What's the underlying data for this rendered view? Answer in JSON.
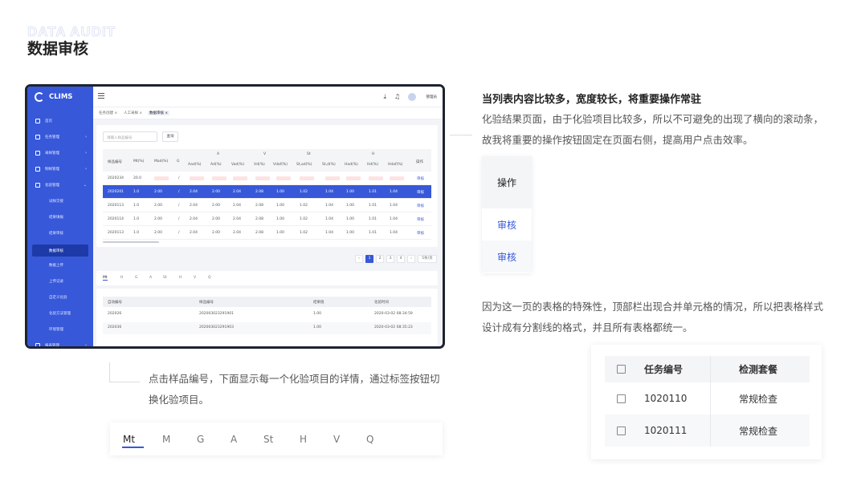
{
  "page": {
    "eyebrow": "DATA AUDIT",
    "title": "数据审核"
  },
  "app": {
    "logo": "CLIMS",
    "user": "管理员",
    "sidebar": {
      "items": [
        {
          "label": "首页"
        },
        {
          "label": "任务管理"
        },
        {
          "label": "采样管理"
        },
        {
          "label": "制样管理"
        },
        {
          "label": "化验管理"
        }
      ],
      "sub_items": [
        {
          "label": "试样交接"
        },
        {
          "label": "结果填报"
        },
        {
          "label": "结果审核"
        }
      ],
      "active": "数据审核",
      "sub_items_after": [
        {
          "label": "数据上传"
        },
        {
          "label": "上传记录"
        },
        {
          "label": "自定义化验"
        },
        {
          "label": "化验方法管理"
        },
        {
          "label": "环境管理"
        }
      ],
      "bottom": "报表管理"
    },
    "breadcrumbs": [
      "任务创建 ×",
      "人工采样 ×",
      "数据审核 ×"
    ],
    "search_placeholder": "请输入样品编号",
    "search_button": "查询",
    "table": {
      "group_headers": [
        "A",
        "V",
        "St",
        "H"
      ],
      "columns": [
        "样品编号",
        "Mt(%)",
        "Mad(%)",
        "G",
        "Aad(%)",
        "Ad(%)",
        "Vad(%)",
        "Vd(%)",
        "Vdaf(%)",
        "St,ad(%)",
        "St,d(%)",
        "Had(%)",
        "Hd(%)",
        "Hdaf(%)",
        "操作"
      ],
      "rows": [
        {
          "id": "2020234",
          "mt": "20.0",
          "mad": "",
          "g": "/",
          "aad": "",
          "ad": "",
          "vad": "",
          "vd": "",
          "vdaf": "",
          "stad": "",
          "std": "",
          "had": "",
          "hd": "",
          "hdaf": "",
          "op": "审核",
          "flag": true
        },
        {
          "id": "2020201",
          "mt": "1.0",
          "mad": "2.00",
          "g": "/",
          "aad": "2.04",
          "ad": "2.00",
          "vad": "2.04",
          "vd": "2.08",
          "vdaf": "1.00",
          "stad": "1.02",
          "std": "1.04",
          "had": "1.00",
          "hd": "1.01",
          "hdaf": "1.04",
          "op": "审核",
          "selected": true
        },
        {
          "id": "2020113",
          "mt": "1.0",
          "mad": "2.00",
          "g": "/",
          "aad": "2.04",
          "ad": "2.00",
          "vad": "2.04",
          "vd": "2.08",
          "vdaf": "1.00",
          "stad": "1.02",
          "std": "1.04",
          "had": "1.00",
          "hd": "1.01",
          "hdaf": "1.04",
          "op": "审核"
        },
        {
          "id": "2020114",
          "mt": "1.0",
          "mad": "2.00",
          "g": "/",
          "aad": "2.04",
          "ad": "2.00",
          "vad": "2.04",
          "vd": "2.08",
          "vdaf": "1.00",
          "stad": "1.02",
          "std": "1.04",
          "had": "1.00",
          "hd": "1.01",
          "hdaf": "1.04",
          "op": "审核"
        },
        {
          "id": "2020113",
          "mt": "1.0",
          "mad": "2.00",
          "g": "/",
          "aad": "2.04",
          "ad": "2.00",
          "vad": "2.04",
          "vd": "2.08",
          "vdaf": "1.00",
          "stad": "1.02",
          "std": "1.04",
          "had": "1.00",
          "hd": "1.01",
          "hdaf": "1.04",
          "op": "审核"
        }
      ]
    },
    "pager": {
      "prev": "‹",
      "pages": [
        "1",
        "2",
        "3",
        "4"
      ],
      "next": "›",
      "size": "5条/页"
    },
    "detail_tabs": [
      "Mt",
      "H",
      "G",
      "A",
      "St",
      "H",
      "V",
      "Q"
    ],
    "detail_table": {
      "columns": [
        "自动编号",
        "样品编号",
        "结果值",
        "化验时间"
      ],
      "rows": [
        [
          "202026",
          "202003023291901",
          "1.00",
          "2020-03-02 08:34:59"
        ],
        [
          "202036",
          "202003023291903",
          "1.00",
          "2020-03-02 08:35:23"
        ]
      ]
    }
  },
  "annotations": {
    "note1_title": "当列表内容比较多，宽度较长，将重要操作常驻",
    "note1_body": "化验结果页面，由于化验项目比较多，所以不可避免的出现了横向的滚动条，故我将重要的操作按钮固定在页面右侧，提高用户点击效率。",
    "op_card": {
      "header": "操作",
      "cells": [
        "审核",
        "审核"
      ]
    },
    "note2_body": "因为这一页的表格的特殊性，顶部栏出现合并单元格的情况，所以把表格样式设计成有分割线的格式，并且所有表格都统一。",
    "task_table": {
      "columns": [
        "任务编号",
        "检测套餐"
      ],
      "rows": [
        [
          "1020110",
          "常规检查"
        ],
        [
          "1020111",
          "常规检查"
        ]
      ]
    },
    "note3_body": "点击样品编号，下面显示每一个化验项目的详情，通过标签按钮切换化验项目。",
    "tabs": [
      "Mt",
      "M",
      "G",
      "A",
      "St",
      "H",
      "V",
      "Q"
    ],
    "active_tab": "Mt"
  },
  "colors": {
    "brand": "#3758d8",
    "brand_dark": "#1e3aa8",
    "text": "#333333",
    "muted": "#555555"
  }
}
